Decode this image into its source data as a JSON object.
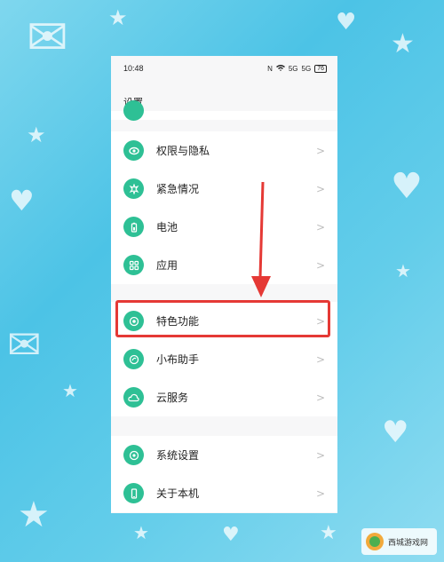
{
  "status_bar": {
    "time": "10:48",
    "icons": [
      "N",
      "wifi",
      "5G",
      "5G",
      "76"
    ]
  },
  "settings": {
    "title": "设置",
    "group1": [
      {
        "label": "权限与隐私",
        "icon": "privacy-icon"
      },
      {
        "label": "紧急情况",
        "icon": "emergency-icon"
      },
      {
        "label": "电池",
        "icon": "battery-icon"
      },
      {
        "label": "应用",
        "icon": "apps-icon"
      }
    ],
    "group2": [
      {
        "label": "特色功能",
        "icon": "features-icon"
      },
      {
        "label": "小布助手",
        "icon": "assistant-icon"
      },
      {
        "label": "云服务",
        "icon": "cloud-icon"
      }
    ],
    "group3": [
      {
        "label": "系统设置",
        "icon": "system-icon"
      },
      {
        "label": "关于本机",
        "icon": "phone-icon"
      }
    ],
    "chevron": ">"
  },
  "watermark": {
    "text": "西城游戏网"
  }
}
